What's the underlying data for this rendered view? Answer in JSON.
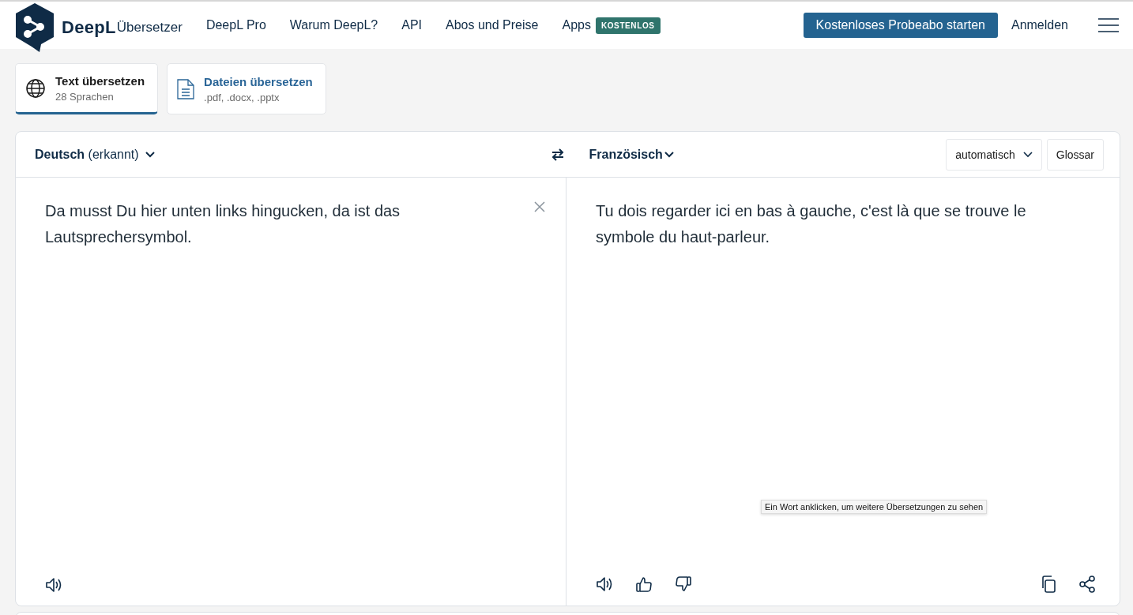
{
  "header": {
    "logo_text": "DeepL",
    "product": "Übersetzer",
    "nav": [
      {
        "label": "DeepL Pro"
      },
      {
        "label": "Warum DeepL?"
      },
      {
        "label": "API"
      },
      {
        "label": "Abos und Preise"
      },
      {
        "label": "Apps",
        "badge": "KOSTENLOS"
      }
    ],
    "cta": "Kostenloses Probeabo starten",
    "login": "Anmelden"
  },
  "tabs": [
    {
      "kind": "text",
      "title": "Text übersetzen",
      "subtitle": "28 Sprachen",
      "selected": true
    },
    {
      "kind": "file",
      "title": "Dateien übersetzen",
      "subtitle": ".pdf, .docx, .pptx",
      "selected": false
    }
  ],
  "translator": {
    "source_language": "**Deutsch** (erkannt)",
    "target_language": "Französisch",
    "formality": "automatisch",
    "glossary": "Glossar",
    "source_text": "Da musst Du hier unten links hingucken, da ist das Lautsprechersymbol.",
    "target_text": "Tu dois regarder ici en bas à gauche, c'est là que se trouve le symbole du haut-parleur.",
    "tooltip": "Ein Wort anklicken, um weitere Übersetzungen zu sehen"
  }
}
